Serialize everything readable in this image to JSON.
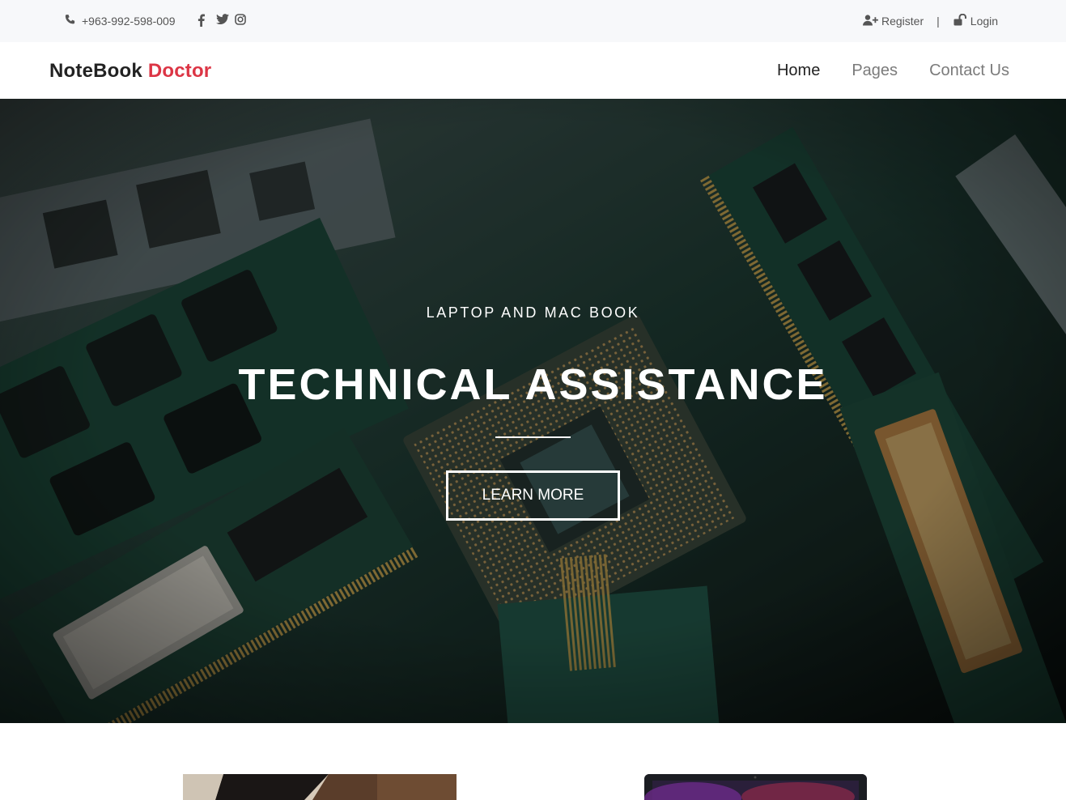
{
  "topbar": {
    "phone": "+963-992-598-009",
    "social": [
      "facebook-icon",
      "twitter-icon",
      "instagram-icon"
    ],
    "register_label": "Register",
    "separator": "|",
    "login_label": "Login"
  },
  "brand": {
    "name_part1": "NoteBook",
    "name_part2": "Doctor",
    "accent_color": "#dc3545"
  },
  "nav": {
    "items": [
      {
        "label": "Home",
        "active": true
      },
      {
        "label": "Pages",
        "active": false
      },
      {
        "label": "Contact Us",
        "active": false
      }
    ]
  },
  "hero": {
    "eyebrow": "LAPTOP AND MAC BOOK",
    "title": "TECHNICAL ASSISTANCE",
    "button_label": "LEARN MORE",
    "background": "computer-hardware-photo"
  }
}
